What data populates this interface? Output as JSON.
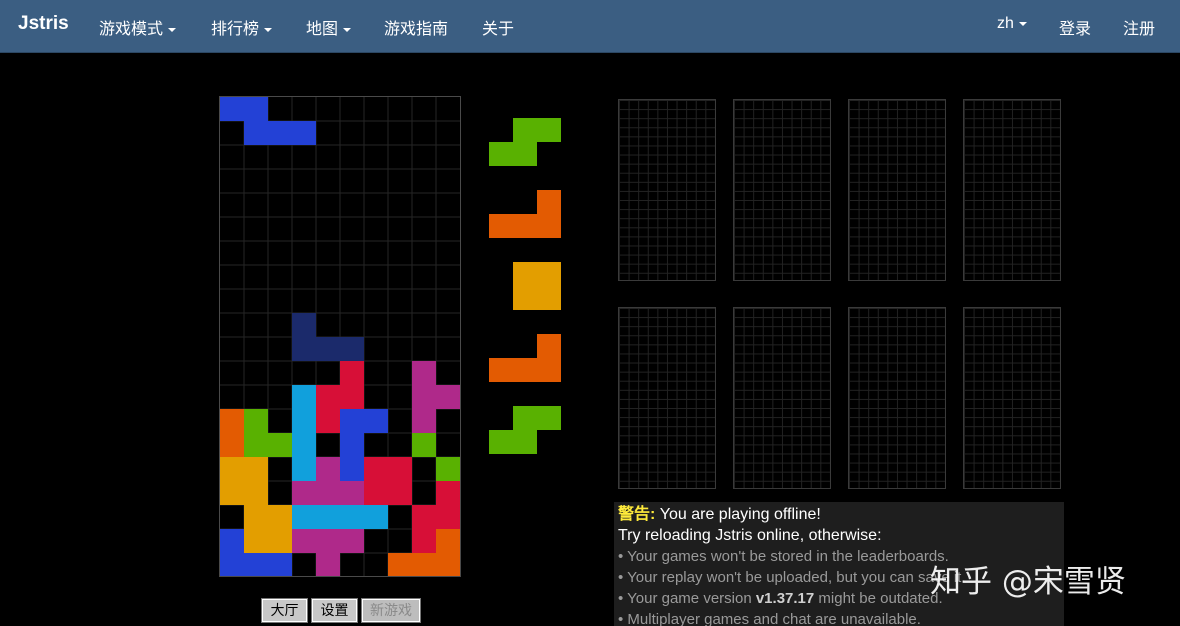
{
  "navbar": {
    "brand": "Jstris",
    "items": [
      {
        "label": "游戏模式",
        "dropdown": true
      },
      {
        "label": "排行榜",
        "dropdown": true
      },
      {
        "label": "地图",
        "dropdown": true
      },
      {
        "label": "游戏指南",
        "dropdown": false
      },
      {
        "label": "关于",
        "dropdown": false
      }
    ],
    "language": "zh",
    "login": "登录",
    "register": "注册"
  },
  "colors": {
    "I": "#11a0dc",
    "J": "#2341d6",
    "L": "#e35b02",
    "O": "#e39e00",
    "S": "#59b101",
    "T": "#af298a",
    "Z": "#d70f37",
    "ghost": "#1b2a6b"
  },
  "board": {
    "cols": 10,
    "rows": 20,
    "cells": [
      "JJ........",
      ".JJJ......",
      "..........",
      "..........",
      "..........",
      "..........",
      "..........",
      "..........",
      "..........",
      "..........",
      "..........",
      "..........",
      "...G......",
      "...GGG....",
      ".....Z..T.",
      "...IZZ..TT",
      "LS.IZJJ.T.",
      "LSSI.J..S.",
      "OO.ITJZZ.S",
      "OO.TTTZZ.Z",
      ".OOIIII.ZZ",
      "JOOTTT..ZL",
      "JJJ.T..LLL"
    ]
  },
  "next_queue": [
    "S",
    "L",
    "O",
    "L",
    "S"
  ],
  "controls": {
    "lobby": "大厅",
    "settings": "设置",
    "new_game": "新游戏"
  },
  "warning": {
    "label": "警告",
    "headline": " You are playing offline!",
    "line2": "Try reloading Jstris online, otherwise:",
    "bullets": [
      "• Your games won't be stored in the leaderboards.",
      "• Your replay won't be uploaded, but you can save it.",
      "• Your game version",
      "• Multiplayer games and chat are unavailable."
    ],
    "version": "v1.37.17",
    "version_suffix": " might be outdated."
  },
  "watermark": "知乎 @宋雪贤"
}
